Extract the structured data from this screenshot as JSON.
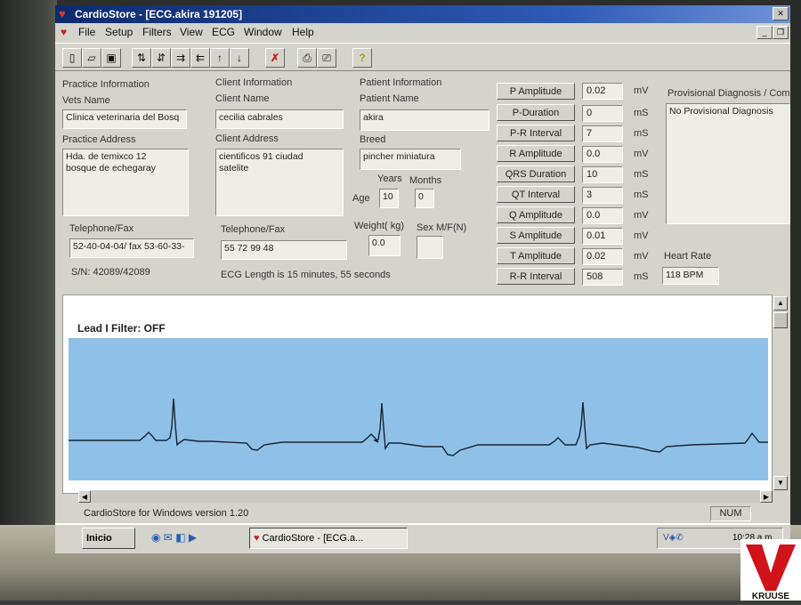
{
  "window": {
    "title": "CardioStore - [ECG.akira 191205]"
  },
  "menu": [
    "File",
    "Setup",
    "Filters",
    "View",
    "ECG",
    "Window",
    "Help"
  ],
  "toolbar_icons": [
    "new-icon",
    "open-icon",
    "save-icon",
    "arrow-up-right-icon",
    "arrow-down-up-icon",
    "arrow-right-icon",
    "arrow-left-icon",
    "arrow-up-icon",
    "arrow-down-icon",
    "delete-icon",
    "print-icon",
    "print-preview-icon",
    "help-icon"
  ],
  "practice": {
    "section": "Practice Information",
    "vets_name_label": "Vets Name",
    "vets_name": "Clinica veterinaria del Bosq",
    "address_label": "Practice Address",
    "address": "Hda. de temixco 12\nbosque de echegaray",
    "phone_label": "Telephone/Fax",
    "phone": "52-40-04-04/ fax 53-60-33-",
    "serial": "S/N: 42089/42089"
  },
  "client": {
    "section": "Client Information",
    "name_label": "Client Name",
    "name": "cecilia cabrales",
    "address_label": "Client Address",
    "address": "cientificos 91  ciudad\nsatelite",
    "phone_label": "Telephone/Fax",
    "phone": "55 72 99 48",
    "ecg_length": "ECG Length is 15 minutes, 55 seconds"
  },
  "patient": {
    "section": "Patient Information",
    "name_label": "Patient Name",
    "name": "akira",
    "breed_label": "Breed",
    "breed": "pincher miniatura",
    "age_label": "Age",
    "years_label": "Years",
    "months_label": "Months",
    "years": "10",
    "months": "0",
    "weight_label": "Weight( kg)",
    "weight": "0.0",
    "sex_label": "Sex M/F(N)",
    "sex": ""
  },
  "parameters": [
    {
      "label": "P Amplitude",
      "value": "0.02",
      "unit": "mV"
    },
    {
      "label": "P-Duration",
      "value": "0",
      "unit": "mS"
    },
    {
      "label": "P-R Interval",
      "value": "7",
      "unit": "mS"
    },
    {
      "label": "R Amplitude",
      "value": "0.0",
      "unit": "mV"
    },
    {
      "label": "QRS Duration",
      "value": "10",
      "unit": "mS"
    },
    {
      "label": "QT Interval",
      "value": "3",
      "unit": "mS"
    },
    {
      "label": "Q Amplitude",
      "value": "0.0",
      "unit": "mV"
    },
    {
      "label": "S Amplitude",
      "value": "0.01",
      "unit": "mV"
    },
    {
      "label": "T Amplitude",
      "value": "0.02",
      "unit": "mV"
    },
    {
      "label": "R-R Interval",
      "value": "508",
      "unit": "mS"
    }
  ],
  "diagnosis": {
    "label": "Provisional Diagnosis / Comments",
    "text": "No Provisional Diagnosis"
  },
  "heart_rate": {
    "label": "Heart Rate",
    "value": "118 BPM"
  },
  "ecg": {
    "title": "Lead I  Filter: OFF",
    "trace_color": "#1a2230",
    "background": "#8fc0e8"
  },
  "statusbar": {
    "text": "CardioStore for Windows version 1.20",
    "num": "NUM"
  },
  "taskbar": {
    "start": "Inicio",
    "task": "CardioStore - [ECG.a...",
    "clock": "10:28 a.m."
  },
  "brand": {
    "logo_text": "KRUUSE",
    "color": "#d0121b"
  }
}
